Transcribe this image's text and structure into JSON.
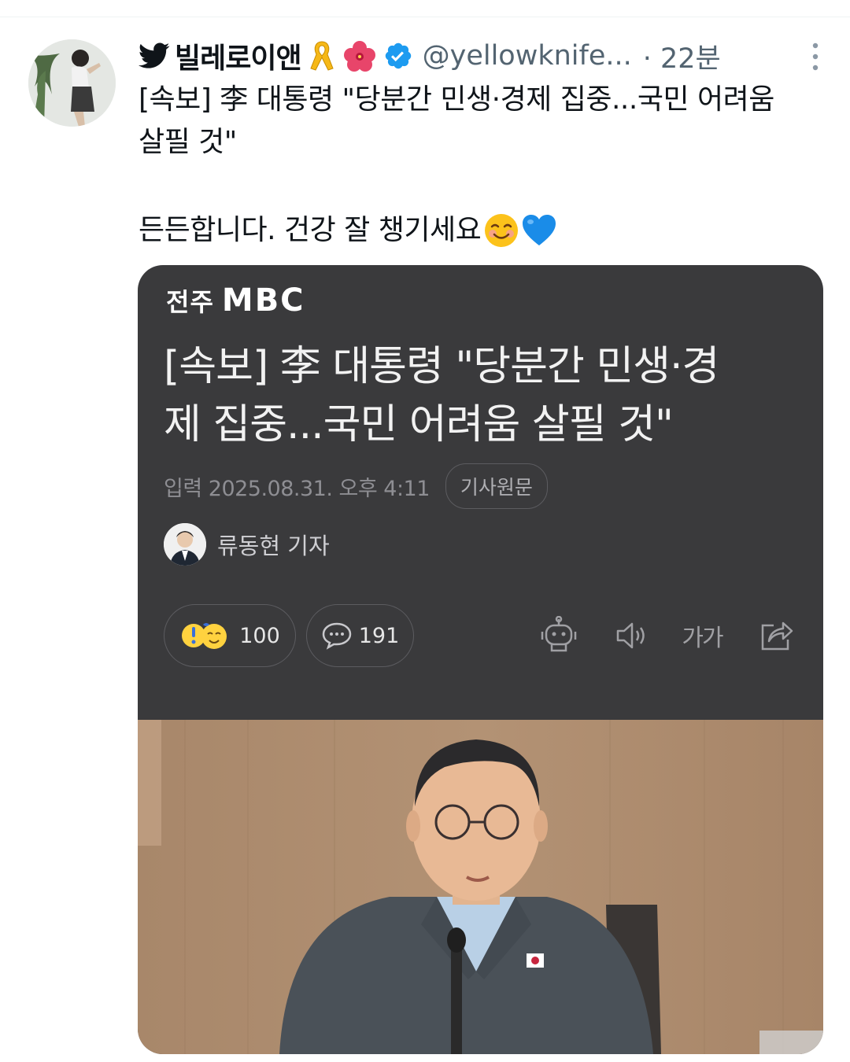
{
  "tweet": {
    "display_name": "빌레로이앤",
    "handle": "@yellowknife...",
    "time": "· 22분",
    "text_line1": "[속보] 李 대통령 \"당분간 민생·경제 집중...국민 어려움",
    "text_line1b": "살필 것\"",
    "text_line2": "든든합니다. 건강 잘 챙기세요",
    "icons": [
      "twitter-bird-icon",
      "yellow-ribbon-emoji",
      "hibiscus-emoji",
      "verified-badge-icon",
      "more-options-icon",
      "smiling-face-emoji",
      "blue-heart-emoji"
    ]
  },
  "article_card": {
    "logo_text": "전주",
    "logo_brand": "MBC",
    "headline_line1": "[속보]  李 대통령 \"당분간 민생·경",
    "headline_line2": "제 집중...국민 어려움 살필 것\"",
    "date": "입력 2025.08.31. 오후 4:11",
    "original_button": "기사원문",
    "reporter": "류동현 기자",
    "reaction_count": "100",
    "comment_count": "191",
    "font_size_tool": "가가",
    "colors": {
      "card_bg": "#3a3a3c",
      "accent_blue": "#1d9bf0"
    }
  }
}
